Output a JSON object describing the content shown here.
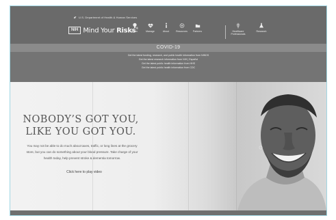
{
  "top_bar": {
    "agency": "U.S. Department of Health & Human Services"
  },
  "logo": {
    "badge": "NIH",
    "name_light": "Mind Your ",
    "name_bold": "Risks",
    "mark": "®"
  },
  "nav": [
    {
      "label": "Know",
      "icon": "lightbulb-icon"
    },
    {
      "label": "Manage",
      "icon": "heart-icon"
    },
    {
      "label": "About",
      "icon": "info-icon"
    },
    {
      "label": "Resources",
      "icon": "gear-icon"
    },
    {
      "label": "Partners",
      "icon": "folder-icon"
    }
  ],
  "nav_secondary": [
    {
      "label": "Healthcare Professionals",
      "icon": "caduceus-icon"
    },
    {
      "label": "Research",
      "icon": "flask-icon"
    }
  ],
  "covid": {
    "title": "COVID-19",
    "links": [
      "Get the latest funding, research, and public health information from NINDS",
      "Get the latest research information from NIH | Español",
      "Get the latest public health information from HHS",
      "Get the latest public health information from CDC"
    ]
  },
  "hero": {
    "headline_1": "NOBODY’S GOT YOU,",
    "headline_2": "LIKE YOU GOT YOU.",
    "body_1": "You may not be able to do much about taxes, traffic, or long lines at the grocery",
    "body_2": "store, but you can do something about your blood pressure. Take charge of your",
    "body_3": "health today, help prevent stroke & dementia tomorrow.",
    "cta": "Click here to play video"
  },
  "colors": {
    "header": "#6a6a6a",
    "covid_bar": "#8b8b8b",
    "links_bar": "#747474",
    "frame_border": "#9fd6e3"
  }
}
